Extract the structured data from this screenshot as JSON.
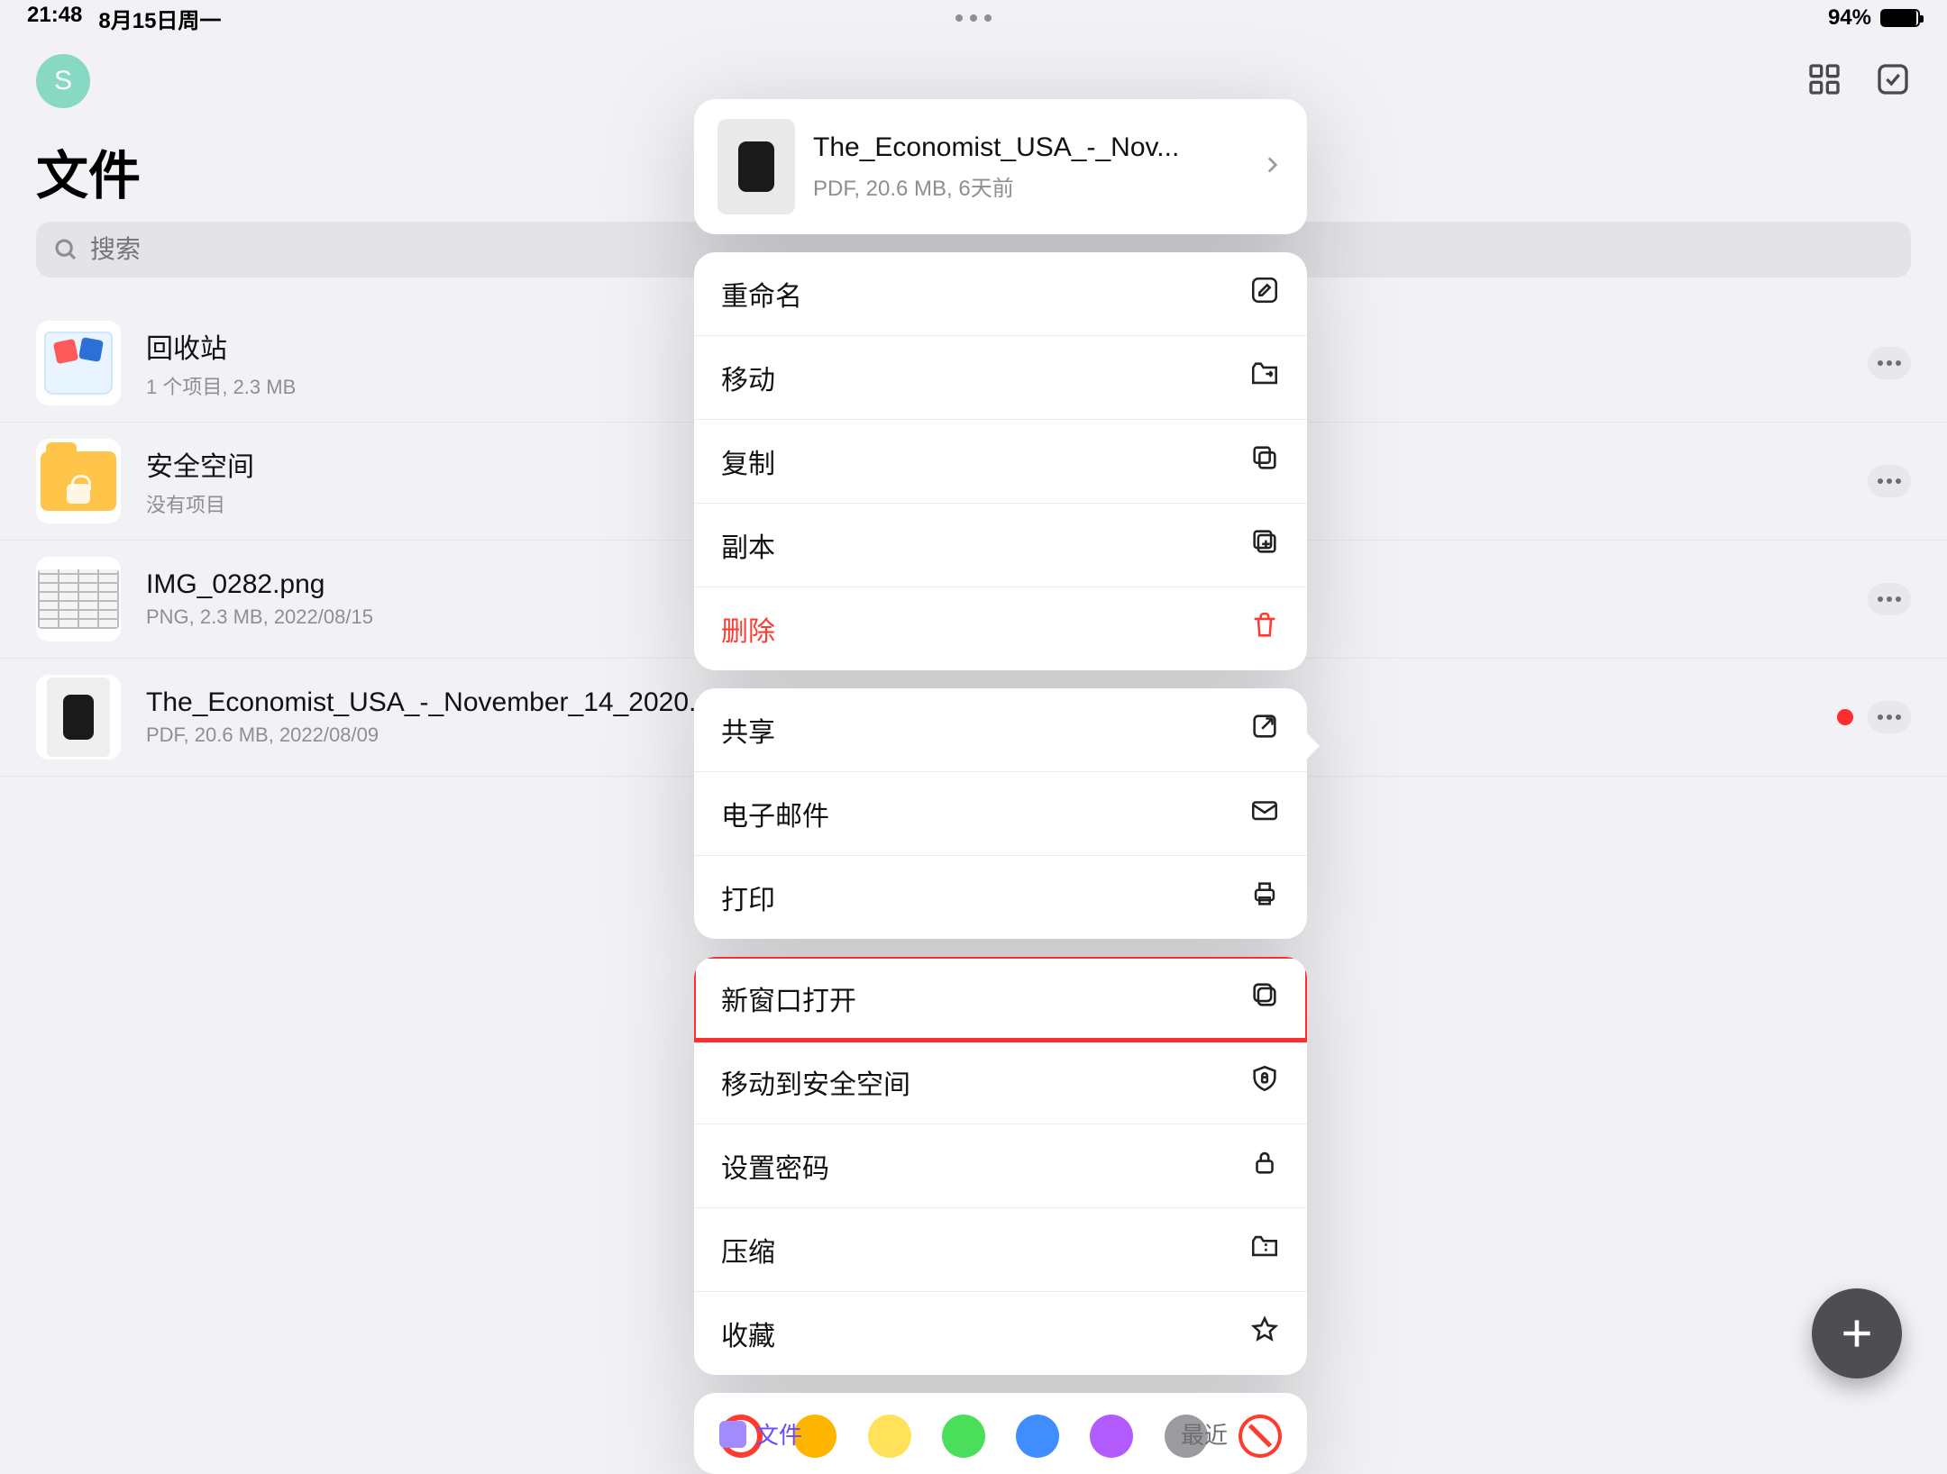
{
  "status": {
    "time": "21:48",
    "date": "8月15日周一",
    "battery_pct": "94%",
    "battery_fill_pct": 94
  },
  "header": {
    "avatar_initial": "S",
    "page_title": "文件"
  },
  "search": {
    "placeholder": "搜索"
  },
  "files": [
    {
      "name": "回收站",
      "meta": "1 个项目, 2.3 MB",
      "thumb": "trash",
      "has_more": true
    },
    {
      "name": "安全空间",
      "meta": "没有项目",
      "thumb": "secure",
      "has_more": true
    },
    {
      "name": "IMG_0282.png",
      "meta": "PNG, 2.3 MB, 2022/08/15",
      "thumb": "img",
      "has_more": true
    },
    {
      "name": "The_Economist_USA_-_November_14_2020.pdf",
      "meta": "PDF, 20.6 MB, 2022/08/09",
      "thumb": "pdf",
      "has_more": true,
      "has_red_dot": true
    }
  ],
  "popup": {
    "header": {
      "name": "The_Economist_USA_-_Nov...",
      "meta": "PDF, 20.6 MB, 6天前"
    },
    "group1": [
      {
        "label": "重命名",
        "icon": "rename",
        "key": "rename"
      },
      {
        "label": "移动",
        "icon": "move",
        "key": "move"
      },
      {
        "label": "复制",
        "icon": "copy",
        "key": "copy"
      },
      {
        "label": "副本",
        "icon": "duplicate",
        "key": "duplicate"
      },
      {
        "label": "删除",
        "icon": "trash",
        "key": "delete",
        "danger": true
      }
    ],
    "group2": [
      {
        "label": "共享",
        "icon": "share",
        "key": "share"
      },
      {
        "label": "电子邮件",
        "icon": "mail",
        "key": "email"
      },
      {
        "label": "打印",
        "icon": "print",
        "key": "print"
      }
    ],
    "group3": [
      {
        "label": "新窗口打开",
        "icon": "newwin",
        "key": "open-new-window",
        "highlight": true
      },
      {
        "label": "移动到安全空间",
        "icon": "shield",
        "key": "move-secure"
      },
      {
        "label": "设置密码",
        "icon": "lock",
        "key": "set-password"
      },
      {
        "label": "压缩",
        "icon": "zip",
        "key": "compress"
      },
      {
        "label": "收藏",
        "icon": "star",
        "key": "favorite"
      }
    ],
    "colors": [
      {
        "key": "selected-red",
        "type": "ring",
        "hex": "#ff3b30"
      },
      {
        "key": "orange",
        "type": "solid",
        "hex": "#ffb400"
      },
      {
        "key": "yellow",
        "type": "solid",
        "hex": "#ffe25a"
      },
      {
        "key": "green",
        "type": "solid",
        "hex": "#4ade5b"
      },
      {
        "key": "blue",
        "type": "solid",
        "hex": "#3f8dff"
      },
      {
        "key": "purple",
        "type": "solid",
        "hex": "#b25cff"
      },
      {
        "key": "gray",
        "type": "solid",
        "hex": "#9b9ba0"
      },
      {
        "key": "none",
        "type": "none",
        "hex": "#ff3b30"
      }
    ]
  },
  "bottom_tabs": {
    "left": "文件",
    "right": "最近"
  }
}
